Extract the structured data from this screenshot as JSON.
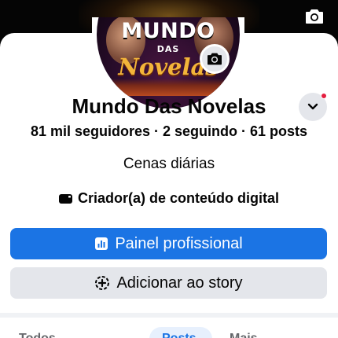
{
  "profile": {
    "name": "Mundo Das Novelas",
    "stats": "81 mil seguidores · 2 seguindo · 61 posts",
    "bio": "Cenas diárias",
    "category": "Criador(a) de conteúdo digital",
    "avatar_text": {
      "line1": "MUNDO",
      "line2": "DAS",
      "line3": "Novelas"
    }
  },
  "actions": {
    "primary_label": "Painel profissional",
    "secondary_label": "Adicionar ao story"
  },
  "tabs": [
    {
      "label": "Todos"
    },
    {
      "label": "Posts"
    },
    {
      "label": "Mais"
    }
  ],
  "icons": {
    "cover_camera": "camera-icon",
    "avatar_camera": "camera-icon",
    "menu": "chevron-down-icon",
    "category": "video-camera-icon",
    "dashboard": "bar-chart-icon",
    "story": "add-story-icon"
  },
  "colors": {
    "accent": "#1b74e4",
    "notification": "#e41e3f",
    "secondary_bg": "#e4e6eb"
  }
}
